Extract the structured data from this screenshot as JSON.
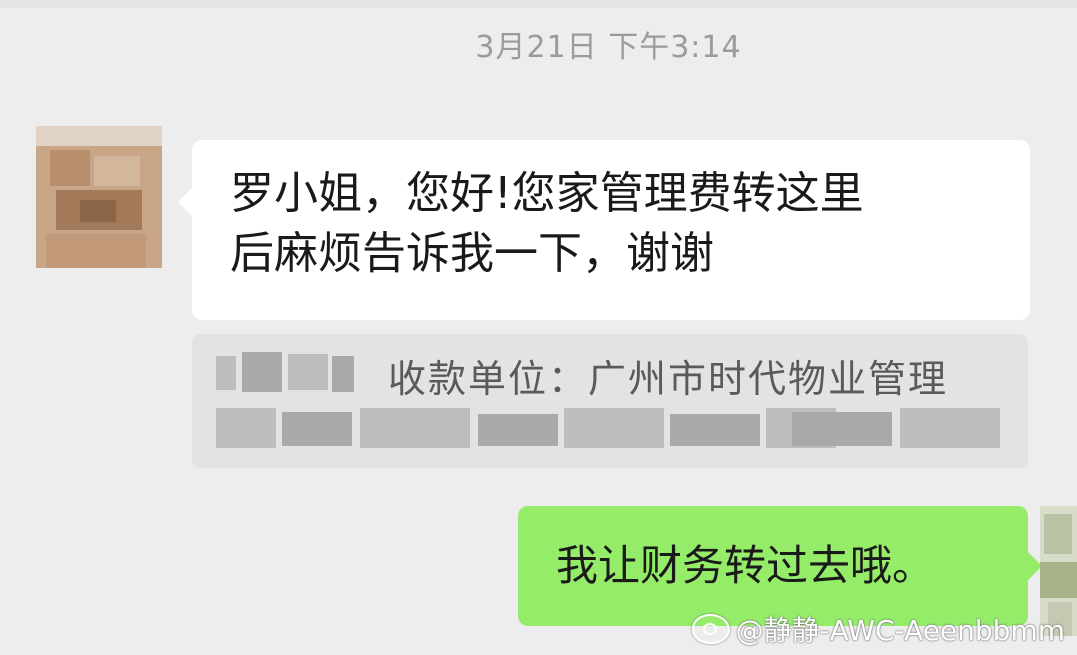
{
  "timestamp": "3月21日 下午3:14",
  "incoming_message": {
    "text_line1": "罗小姐，您好!您家管理费转这里",
    "text_line2": "后麻烦告诉我一下，谢谢"
  },
  "payment_card": {
    "payee_text": "收款单位：广州市时代物业管理"
  },
  "outgoing_message": {
    "text": "我让财务转过去哦。"
  },
  "watermark": {
    "handle": "@静静-AWC-Aeenbbmm",
    "logo_icon": "weibo-logo-icon"
  },
  "colors": {
    "background": "#ededed",
    "incoming_bubble": "#ffffff",
    "outgoing_bubble": "#95ec69",
    "timestamp": "#9b9b9b"
  }
}
